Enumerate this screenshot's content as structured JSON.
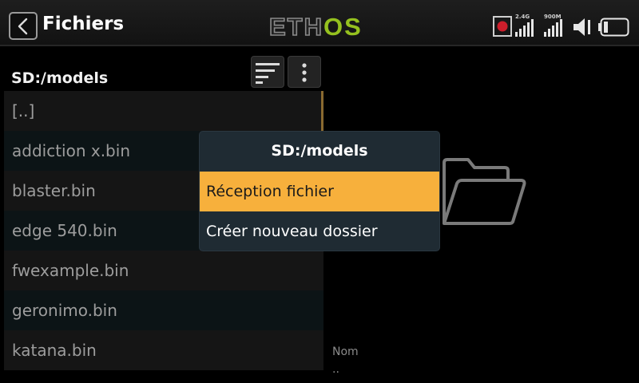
{
  "header": {
    "title": "Fichiers",
    "logo_part1": "ETH",
    "logo_part2": "OS",
    "signals": [
      {
        "label": "2.4G"
      },
      {
        "label": "900M"
      }
    ]
  },
  "colors": {
    "accent": "#f7b03c",
    "logo_green": "#95c11f",
    "record_red": "#cc1e2b",
    "popup_bg": "#1f2b33"
  },
  "icons": {
    "back": "chevron-left-icon",
    "sort": "sort-lines-icon",
    "more": "more-vertical-icon",
    "record": "record-icon",
    "signal": "signal-bars-icon",
    "speaker": "speaker-icon",
    "battery": "battery-icon",
    "folder": "folder-open-icon"
  },
  "browser": {
    "path": "SD:/models",
    "files": [
      {
        "name": "[..]"
      },
      {
        "name": "addiction x.bin"
      },
      {
        "name": "blaster.bin"
      },
      {
        "name": "edge 540.bin"
      },
      {
        "name": "fwexample.bin"
      },
      {
        "name": "geronimo.bin"
      },
      {
        "name": "katana.bin"
      }
    ]
  },
  "details": {
    "label": "Nom",
    "value": ".."
  },
  "popup": {
    "title": "SD:/models",
    "items": [
      {
        "label": "Réception fichier",
        "selected": true
      },
      {
        "label": "Créer nouveau dossier",
        "selected": false
      }
    ]
  }
}
